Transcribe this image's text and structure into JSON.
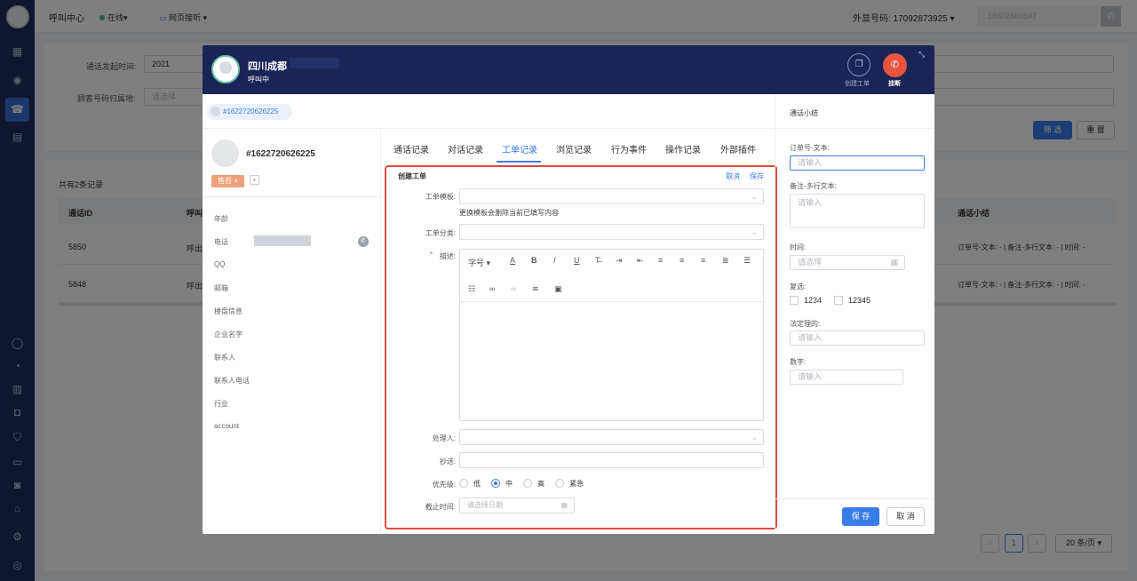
{
  "topbar": {
    "title": "呼叫中心",
    "status": "在线▾",
    "mode": "网页接听 ▾",
    "outbound_label": "外显号码: 17092873925 ▾",
    "phone_input": "18602860597"
  },
  "filters": {
    "call_time_label": "通话发起时间:",
    "call_time_value": "2021",
    "region_label": "顾客号码归属地:",
    "region_placeholder": "请选择",
    "filter_button": "筛 选",
    "reset_button": "重 置"
  },
  "records": {
    "count_label": "共有2条记录",
    "headers": [
      "通话ID",
      "呼叫",
      "通话小结"
    ],
    "rows": [
      {
        "id": "5850",
        "call": "呼出",
        "summary": "订单号-文本: -  |  备注-多行文本: -  |  时间: -"
      },
      {
        "id": "5848",
        "call": "呼出",
        "summary": "订单号-文本: -  |  备注-多行文本: -  |  时间: -"
      }
    ],
    "page": "1",
    "page_size": "20 条/页 ▾"
  },
  "call": {
    "location": "四川成都",
    "status": "呼叫中",
    "create_ticket_label": "创建工单",
    "hangup_label": "挂断"
  },
  "customer": {
    "chip": "#1622720626225",
    "id": "#1622720626225",
    "tag": "售后 ×",
    "add_tag": "+",
    "fields": [
      "年龄",
      "电话",
      "QQ",
      "邮箱",
      "楼盘信息",
      "企业名字",
      "联系人",
      "联系人电话",
      "行业",
      "account"
    ]
  },
  "tabs": [
    "通话记录",
    "对话记录",
    "工单记录",
    "浏览记录",
    "行为事件",
    "操作记录",
    "外部插件"
  ],
  "ticket": {
    "title": "创建工单",
    "cancel": "取消",
    "save": "保存",
    "template_label": "工单模板:",
    "template_hint": "更换模板会删除当前已填写内容",
    "category_label": "工单分类:",
    "description_label": "描述:",
    "toolbar_font": "字号 ▾",
    "handler_label": "处理人:",
    "cc_label": "抄送:",
    "priority_label": "优先级:",
    "priorities": [
      "低",
      "中",
      "高",
      "紧急"
    ],
    "deadline_label": "截止时间:",
    "deadline_placeholder": "请选择日期"
  },
  "summary": {
    "title": "通话小结",
    "order_label": "订单号-文本:",
    "order_placeholder": "请输入",
    "remark_label": "备注-多行文本:",
    "remark_placeholder": "请输入",
    "time_label": "时间:",
    "time_placeholder": "请选择",
    "checkbox_label": "复选:",
    "checkbox_options": [
      "1234",
      "12345"
    ],
    "promise_label": "法定理的:",
    "promise_placeholder": "请输入",
    "number_label": "数字:",
    "number_placeholder": "请输入",
    "save_button": "保 存",
    "cancel_button": "取 消"
  },
  "colors": {
    "accent": "#3a7de8",
    "highlight_border": "#e04b3c",
    "hangup": "#e8553e",
    "tag": "#f0a07a",
    "header": "#1a2557"
  }
}
